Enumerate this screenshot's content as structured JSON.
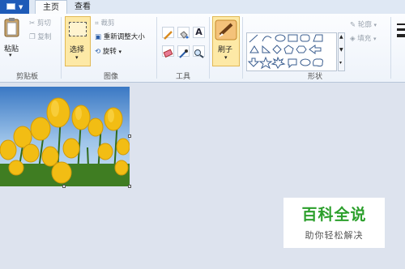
{
  "tabs": {
    "home": "主页",
    "view": "查看"
  },
  "clipboard": {
    "paste": "粘贴",
    "cut": "剪切",
    "copy": "复制",
    "group": "剪贴板"
  },
  "image": {
    "select": "选择",
    "crop": "裁剪",
    "resize": "重新调整大小",
    "rotate": "旋转",
    "group": "图像"
  },
  "tools": {
    "group": "工具"
  },
  "brushes": {
    "label": "刷子"
  },
  "shapes": {
    "outline": "轮廓",
    "fill": "填充",
    "group": "形状"
  },
  "watermark": {
    "title": "百科全说",
    "subtitle": "助你轻松解决"
  }
}
